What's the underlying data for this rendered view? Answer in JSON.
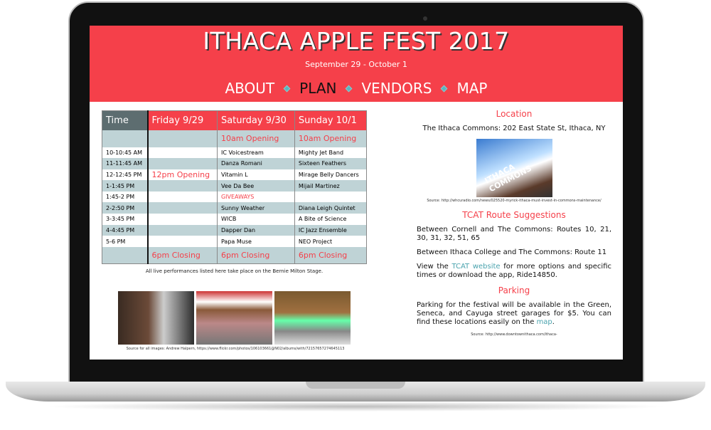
{
  "header": {
    "title": "ITHACA APPLE FEST 2017",
    "dates": "September 29 - October 1"
  },
  "nav": [
    {
      "label": "ABOUT"
    },
    {
      "label": "PLAN",
      "active": true
    },
    {
      "label": "VENDORS"
    },
    {
      "label": "MAP"
    }
  ],
  "schedule": {
    "headers": [
      "Time",
      "Friday 9/29",
      "Saturday 9/30",
      "Sunday 10/1"
    ],
    "opening": [
      "",
      "",
      "10am Opening",
      "10am Opening"
    ],
    "rows": [
      [
        "10-10:45 AM",
        "",
        "IC Voicestream",
        "Mighty Jet Band"
      ],
      [
        "11-11:45 AM",
        "",
        "Danza Romani",
        "Sixteen Feathers"
      ],
      [
        "12-12:45 PM",
        "12pm Opening",
        "Vitamin L",
        "Mirage Belly Dancers"
      ],
      [
        "1-1:45 PM",
        "",
        "Vee Da Bee",
        "Mijail Martinez"
      ],
      [
        "1:45-2 PM",
        "",
        "GIVEAWAYS",
        ""
      ],
      [
        "2-2:50 PM",
        "",
        "Sunny Weather",
        "Diana Leigh Quintet"
      ],
      [
        "3-3:45 PM",
        "",
        "WICB",
        "A Bite of Science"
      ],
      [
        "4-4:45 PM",
        "",
        "Dapper Dan",
        "IC Jazz Ensemble"
      ],
      [
        "5-6 PM",
        "",
        "Papa Muse",
        "NEO Project"
      ]
    ],
    "closing": [
      "",
      "6pm Closing",
      "6pm Closing",
      "6pm Closing"
    ],
    "caption": "All live performances listed here take place on the Bernie Milton Stage."
  },
  "photos_caption": "Source for all images: Andrew Halpern, https://www.flickr.com/photos/106103661@N02/albums/with/72157657274645113",
  "location": {
    "heading": "Location",
    "address": "The Ithaca Commons: 202 East State St, Ithaca, NY",
    "image_text": "ITHACA COMMONS",
    "source": "Source: http://whcuradio.com/news/025520-myrick-ithaca-must-invest-in-commons-maintenance/"
  },
  "tcat": {
    "heading": "TCAT Route Suggestions",
    "cornell": "Between Cornell and The Commons: Routes 10, 21, 30, 31, 32, 51, 65",
    "ic": "Between Ithaca College and The Commons: Route 11",
    "view_pre": "View the ",
    "link": "TCAT website",
    "view_post": " for more options and specific times or download the app, Ride14850."
  },
  "parking": {
    "heading": "Parking",
    "text_pre": "Parking for the festival will be available in the Green, Seneca, and Cayuga street garages for $5. You can find these locations easily on the ",
    "link": "map",
    "text_post": ".",
    "source": "Source: http://www.downtownithaca.com/ithaca-"
  },
  "colors": {
    "brand_red": "#f5404a",
    "row_teal": "#bfd3d6",
    "link": "#4aa3ae"
  }
}
